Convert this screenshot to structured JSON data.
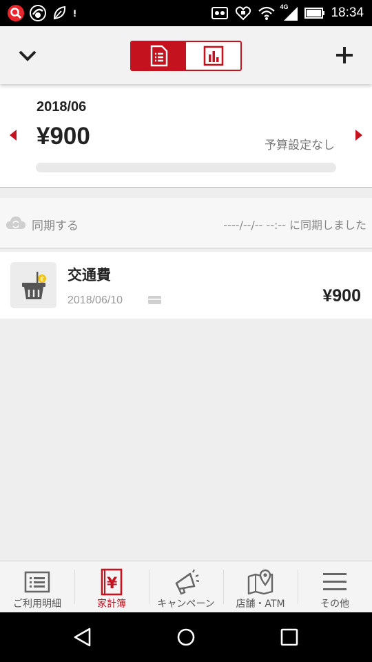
{
  "status_bar": {
    "time": "18:34",
    "network": "4G",
    "icons": [
      "search-app-icon",
      "trend-app-icon",
      "leaf-app-icon",
      "alert-icon",
      "voicemail-icon",
      "heart-icon",
      "wifi-icon",
      "signal-icon",
      "battery-icon"
    ]
  },
  "header": {
    "collapse_icon": "chevron-down-icon",
    "add_icon": "plus-icon",
    "segments": [
      {
        "name": "list-view",
        "icon": "document-list-icon",
        "active": true
      },
      {
        "name": "chart-view",
        "icon": "bar-chart-icon",
        "active": false
      }
    ]
  },
  "budget": {
    "month": "2018/06",
    "total": "¥900",
    "budget_status": "予算設定なし",
    "progress_fraction": 0
  },
  "sync": {
    "label": "同期する",
    "status": "----/--/-- --:-- に同期しました"
  },
  "transactions": [
    {
      "category": "交通費",
      "date": "2018/06/10",
      "amount": "¥900",
      "icon": "shopping-basket-icon",
      "payment_icon": "credit-card-icon"
    }
  ],
  "tabs": [
    {
      "label": "ご利用明細",
      "icon": "statement-icon",
      "active": false
    },
    {
      "label": "家計簿",
      "icon": "household-book-icon",
      "active": true
    },
    {
      "label": "キャンペーン",
      "icon": "megaphone-icon",
      "active": false
    },
    {
      "label": "店舗・ATM",
      "icon": "map-pin-icon",
      "active": false
    },
    {
      "label": "その他",
      "icon": "menu-icon",
      "active": false
    }
  ],
  "colors": {
    "accent": "#c4121f",
    "background": "#eeeeee",
    "text": "#222222",
    "muted": "#888888"
  }
}
